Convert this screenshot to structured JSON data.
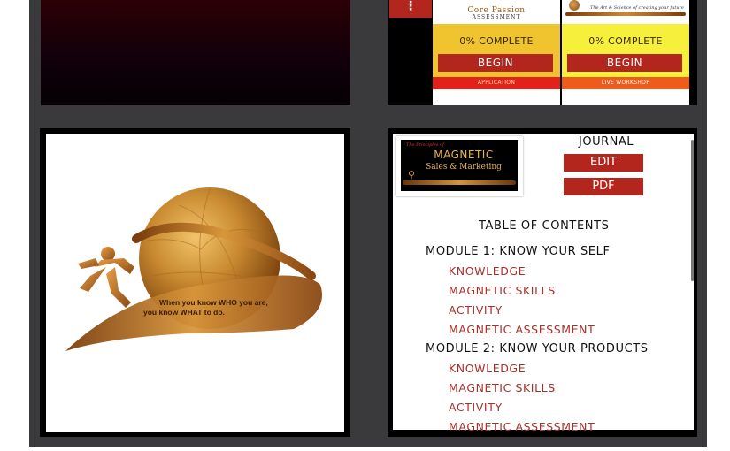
{
  "top_cards": [
    {
      "thumb_title": "Core Passion",
      "thumb_subtitle": "ASSESSMENT",
      "progress_text": "0% COMPLETE",
      "progress_percent": 0,
      "begin_label": "BEGIN",
      "footer_label": "APPLICATION"
    },
    {
      "thumb_tagline": "The Art & Science of creating your future",
      "progress_text": "0% COMPLETE",
      "progress_percent": 0,
      "begin_label": "BEGIN",
      "footer_label": "LIVE WORKSHOP"
    }
  ],
  "logo": {
    "tagline_line1": "When you know WHO you are,",
    "tagline_line2": "you know WHAT to do."
  },
  "journal": {
    "logo_pre": "The Principles of",
    "logo_title": "MAGNETIC",
    "logo_subtitle": "Sales & Marketing",
    "title": "JOURNAL",
    "edit_label": "EDIT",
    "pdf_label": "PDF",
    "toc_title": "TABLE OF CONTENTS",
    "modules": [
      {
        "title": "MODULE 1: KNOW YOUR SELF",
        "items": [
          "KNOWLEDGE",
          "MAGNETIC SKILLS",
          "ACTIVITY",
          "MAGNETIC ASSESSMENT"
        ]
      },
      {
        "title": "MODULE 2: KNOW YOUR PRODUCTS",
        "items": [
          "KNOWLEDGE",
          "MAGNETIC SKILLS",
          "ACTIVITY",
          "MAGNETIC ASSESSMENT"
        ]
      }
    ]
  },
  "colors": {
    "frame": "#3a3a3c",
    "accent_red": "#b3261e",
    "card1_body": "#f0c42e",
    "card2_body": "#f6f03c",
    "toc_link": "#a8302a",
    "gold": "#c98a30"
  },
  "icons": {
    "more_menu": "more-vertical-icon",
    "globe": "globe-icon",
    "runner": "runner-icon"
  }
}
